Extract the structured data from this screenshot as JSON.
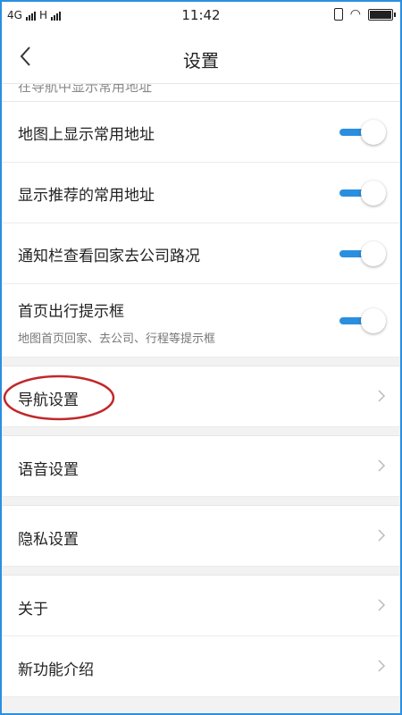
{
  "status_bar": {
    "network": "4G",
    "network2": "H",
    "time": "11:42"
  },
  "header": {
    "title": "设置"
  },
  "partial_text": "在导航中显示常用地址",
  "toggles": [
    {
      "label": "地图上显示常用地址",
      "on": true
    },
    {
      "label": "显示推荐的常用地址",
      "on": true
    },
    {
      "label": "通知栏查看回家去公司路况",
      "on": true
    },
    {
      "label": "首页出行提示框",
      "sub": "地图首页回家、去公司、行程等提示框",
      "on": true
    }
  ],
  "links": [
    {
      "label": "导航设置"
    },
    {
      "label": "语音设置"
    },
    {
      "label": "隐私设置"
    },
    {
      "label": "关于"
    },
    {
      "label": "新功能介绍"
    }
  ],
  "colors": {
    "accent": "#2b8fe0",
    "highlight": "#c0282a"
  }
}
